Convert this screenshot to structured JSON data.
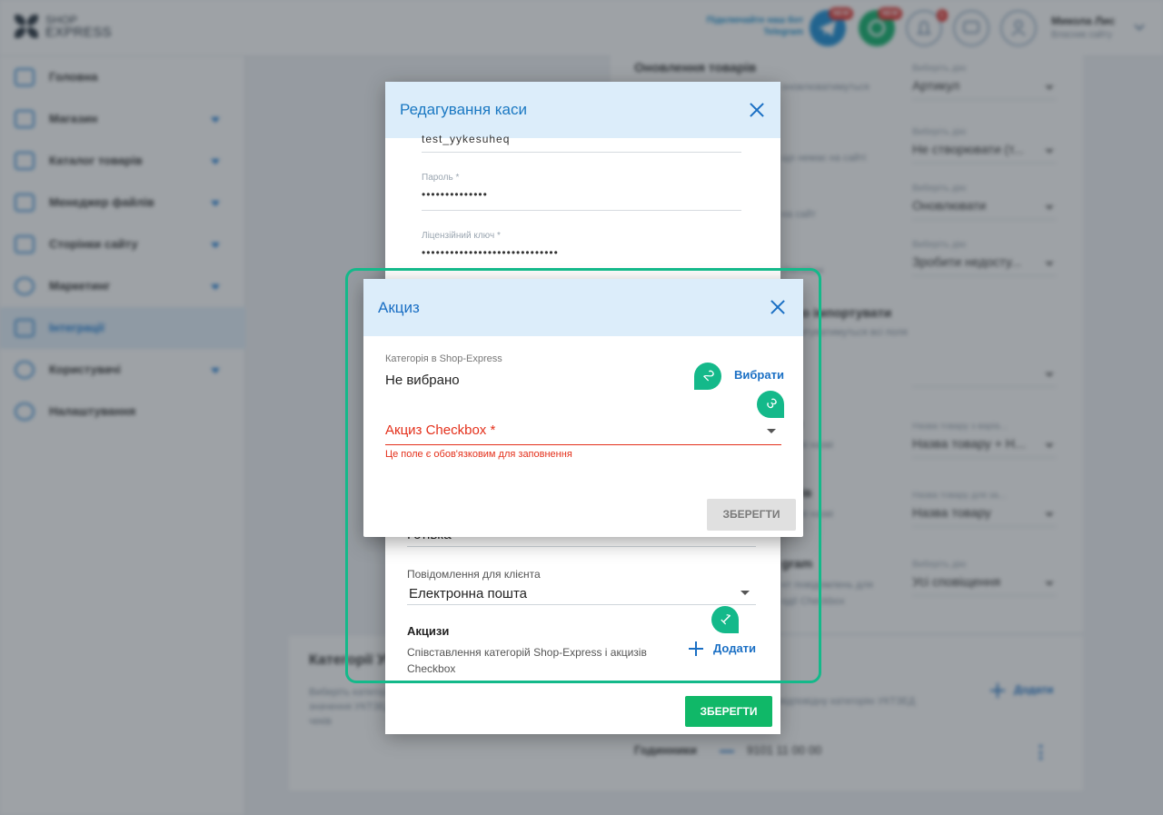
{
  "header": {
    "logo_line1": "SHOP",
    "logo_line2": "EXPRESS",
    "telegram_line1": "Підключайте наш бот",
    "telegram_line2": "Telegram",
    "badge_telegram": "NEW",
    "badge_second": "NEW",
    "badge_notifications": "1",
    "user_name": "Микола Лис",
    "user_subtitle": "Власник сайту"
  },
  "sidebar": {
    "items": [
      {
        "label": "Головна"
      },
      {
        "label": "Магазин"
      },
      {
        "label": "Каталог товарів"
      },
      {
        "label": "Менеджер файлів"
      },
      {
        "label": "Сторінки сайту"
      },
      {
        "label": "Маркетинг"
      },
      {
        "label": "Інтеграції"
      },
      {
        "label": "Користувачі"
      },
      {
        "label": "Налаштування"
      }
    ]
  },
  "background": {
    "section_title": "Оновлення товарів",
    "selects": [
      {
        "label": "Виберіть дію",
        "value": "Артикул"
      },
      {
        "label": "Виберіть дію",
        "value": "Не створювати (т..."
      },
      {
        "label": "Виберіть дію",
        "value": "Оновлювати"
      },
      {
        "label": "Виберіть дію",
        "value": "Зробити недосту..."
      },
      {
        "label": "Назва товару з варіа...",
        "value": "Назва товару + Н..."
      },
      {
        "label": "Назва товару для за...",
        "value": "Назва товару"
      },
      {
        "label": "Виберіть дію",
        "value": "Усі сповіщення"
      }
    ],
    "side_titles": [
      "Оновлення товарів",
      "но імпортувати",
      "и",
      "тів",
      "gram"
    ],
    "side_texts": [
      "оновлюватимуться",
      "що немає на сайті",
      "на сайт",
      "checkbox",
      "ортуватимуться всі поля",
      "нні назві",
      "нні назві",
      "нт повідомлень для",
      "одії Checkbox"
    ],
    "bottom_title": "Категорії УКТЗЕД",
    "bottom_text1": "Виберіть категорію",
    "bottom_text2": "значення УКТЗЕД",
    "bottom_text3": "чеків",
    "uktzed_hint": "відповідну категорію УКТЗЕД",
    "uktzed_add": "Додати",
    "row_name": "Годинники",
    "row_code": "9101 11 00 00"
  },
  "edit_modal": {
    "title": "Редагування каси",
    "login_value": "test_yykesuheq",
    "password_label": "Пароль *",
    "password_value": "••••••••••••••",
    "license_label": "Ліцензійний ключ *",
    "license_value": "•••••••••••••••••••••••••••••",
    "partial_value": "Готівка",
    "message_label": "Повідомлення для клієнта",
    "message_value": "Електронна пошта",
    "excise_title": "Акцизи",
    "excise_desc": "Співставлення категорій Shop-Express і акцизів Checkbox",
    "add_label": "Додати",
    "save_label": "ЗБЕРЕГТИ"
  },
  "excise_modal": {
    "title": "Акциз",
    "category_label": "Категорія в Shop-Express",
    "category_value": "Не вибрано",
    "choose_label": "Вибрати",
    "select_label": "Акциз Checkbox *",
    "error_text": "Це поле є обов'язковим для заповнення",
    "save_label": "ЗБЕРЕГТИ"
  },
  "callouts": [
    "1",
    "2",
    "3"
  ],
  "colors": {
    "accent_blue": "#1a6fc4",
    "modal_header": "#dcedfa",
    "save_green": "#10b868",
    "error_red": "#e4301b",
    "callout_green": "#14b98a"
  }
}
